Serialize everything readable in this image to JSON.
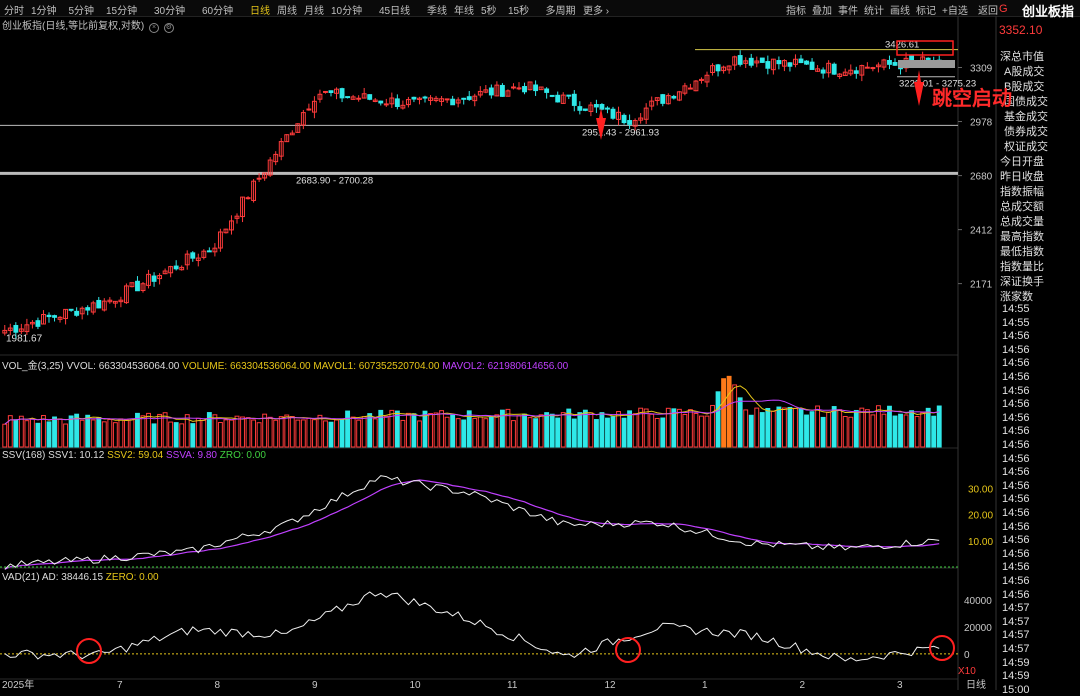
{
  "toolbar": {
    "periods": [
      "分时",
      "1分钟",
      "5分钟",
      "15分钟",
      "30分钟",
      "60分钟",
      "日线",
      "周线",
      "月线",
      "10分钟",
      "45日线",
      "季线",
      "年线",
      "5秒",
      "15秒",
      "多周期",
      "更多 ›"
    ],
    "active_period": "日线",
    "tools": [
      "指标",
      "叠加",
      "事件",
      "统计",
      "画线",
      "标记",
      "+自选",
      "返回"
    ]
  },
  "header": {
    "g_badge": "G",
    "title": "创业板指",
    "price": "3352.10"
  },
  "subtitle": "创业板指(日线,等比前复权,对数)",
  "right_panel": {
    "items_a": [
      "深总市值",
      "A股成交",
      "B股成交",
      "国债成交",
      "基金成交",
      "债券成交",
      "权证成交"
    ],
    "items_b": [
      "今日开盘",
      "昨日收盘",
      "指数振幅",
      "总成交额",
      "总成交量",
      "最高指数",
      "最低指数",
      "指数量比",
      "深证换手",
      "涨家数"
    ],
    "times": [
      "14:55",
      "14:55",
      "14:56",
      "14:56",
      "14:56",
      "14:56",
      "14:56",
      "14:56",
      "14:56",
      "14:56",
      "14:56",
      "14:56",
      "14:56",
      "14:56",
      "14:56",
      "14:56",
      "14:56",
      "14:56",
      "14:56",
      "14:56",
      "14:56",
      "14:56",
      "14:57",
      "14:57",
      "14:57",
      "14:57",
      "14:59",
      "14:59",
      "15:00"
    ]
  },
  "indicators": {
    "vol_label": "VOL_金(3,25)",
    "vvol": "VVOL: 663304536064.00",
    "volume": "VOLUME: 663304536064.00",
    "mavol1": "MAVOL1: 607352520704.00",
    "mavol2": "MAVOL2: 621980614656.00",
    "ssv_label": "SSV(168)",
    "ssv1": "SSV1: 10.12",
    "ssv2": "SSV2: 59.04",
    "ssva": "SSVA: 9.80",
    "ssv_zro": "ZRO: 0.00",
    "vad_label": "VAD(21)",
    "ad": "AD: 38446.15",
    "vad_zro": "ZERO: 0.00",
    "x10": "X10"
  },
  "annotation": {
    "text": "跳空启动",
    "color": "#ff2a2a"
  },
  "colors": {
    "up": "#ff3b3b",
    "down": "#2fe8e8",
    "ma_purple": "#c040ff",
    "ma_orange": "#e6c619",
    "highlight": "#ff7a1a"
  },
  "chart_data": [
    {
      "type": "candlestick",
      "title": "创业板指(日线,等比前复权,对数)",
      "x_ticks": [
        "2025年",
        "7",
        "8",
        "9",
        "10",
        "11",
        "12",
        "1",
        "2",
        "3",
        "日线"
      ],
      "y_ticks": [
        3309,
        2978,
        2680,
        2412,
        2171
      ],
      "ylim": [
        1900,
        3560
      ],
      "scale": "log",
      "keypoints": [
        {
          "month": "start",
          "close": 1981.67
        },
        {
          "month": "7",
          "close": 2100
        },
        {
          "month": "8",
          "close": 2330
        },
        {
          "month": "9",
          "close": 3150
        },
        {
          "month": "10",
          "close": 3080
        },
        {
          "month": "11",
          "close": 3190
        },
        {
          "month": "12",
          "close": 2990
        },
        {
          "month": "1",
          "close": 3370
        },
        {
          "month": "2",
          "close": 3300
        },
        {
          "month": "3",
          "close": 3352.1
        }
      ],
      "price_labels": [
        "3426.61",
        "1981.67",
        "2951.43 - 2961.93",
        "2683.90 - 2700.28",
        "3228.01 - 3275.23"
      ],
      "hlines": [
        {
          "label": "3426.61",
          "value": 3426.61,
          "color": "#d4c84a"
        },
        {
          "label": "2951.43 - 2961.93",
          "value": 2956,
          "color": "#bbbbbb"
        },
        {
          "label": "2683.90 - 2700.28",
          "value": 2692,
          "color": "#bbbbbb"
        },
        {
          "label": "3228.01 - 3275.23",
          "value": 3250,
          "color": "#bbbbbb"
        }
      ]
    },
    {
      "type": "bar",
      "title": "VOL_金(3,25)",
      "series": [
        {
          "name": "VOLUME"
        },
        {
          "name": "MAVOL1"
        },
        {
          "name": "MAVOL2"
        }
      ],
      "last_values": {
        "VOLUME": 663304536064.0,
        "MAVOL1": 607352520704.0,
        "MAVOL2": 621980614656.0
      }
    },
    {
      "type": "line",
      "title": "SSV(168)",
      "y_ticks": [
        30.0,
        20.0,
        10.0
      ],
      "ylim": [
        0,
        40
      ],
      "series": [
        {
          "name": "SSV1",
          "last": 10.12,
          "keypoints": [
            [
              0,
              0.5
            ],
            [
              1,
              3
            ],
            [
              2,
              6
            ],
            [
              3,
              16
            ],
            [
              4,
              34
            ],
            [
              5,
              28
            ],
            [
              6,
              16
            ],
            [
              7,
              17
            ],
            [
              8,
              9
            ],
            [
              9,
              7
            ],
            [
              10,
              10.12
            ]
          ]
        },
        {
          "name": "SSVA",
          "last": 9.8
        }
      ],
      "zro": 0.0
    },
    {
      "type": "line",
      "title": "VAD(21)",
      "y_ticks": [
        40000,
        20000,
        0
      ],
      "ylim": [
        -18000,
        55000
      ],
      "series": [
        {
          "name": "AD",
          "last": 38446.15,
          "keypoints": [
            [
              0,
              0
            ],
            [
              1,
              -1000
            ],
            [
              2,
              18000
            ],
            [
              3,
              14000
            ],
            [
              4,
              47000
            ],
            [
              5,
              25000
            ],
            [
              6,
              -2000
            ],
            [
              7,
              20000
            ],
            [
              8,
              14000
            ],
            [
              9,
              -5000
            ],
            [
              10,
              5000
            ]
          ]
        }
      ],
      "zro": 0.0
    }
  ]
}
